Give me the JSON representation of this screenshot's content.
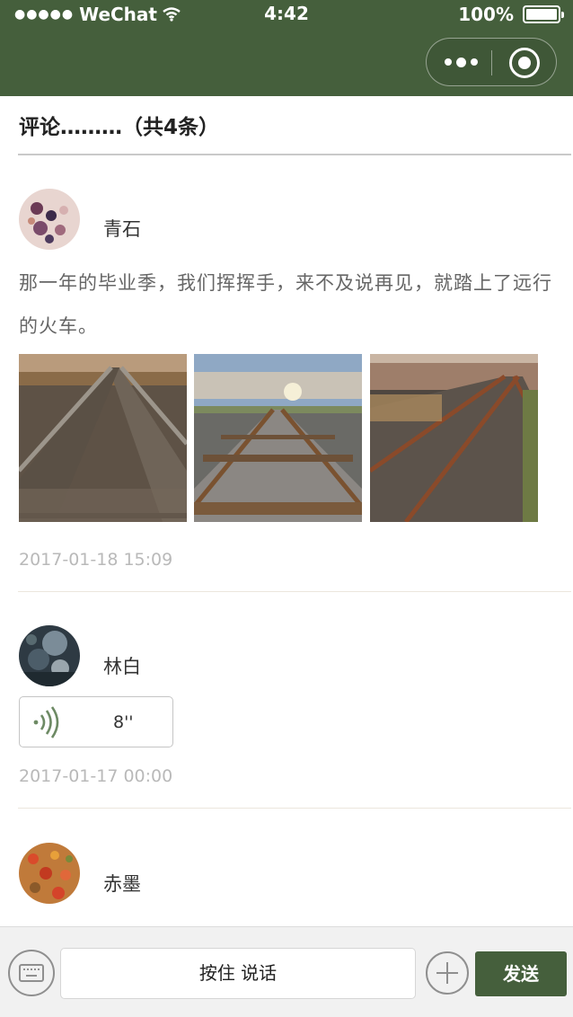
{
  "status_bar": {
    "carrier": "WeChat",
    "time": "4:42",
    "battery": "100%"
  },
  "header": {
    "title": "评论………（共4条）"
  },
  "comments": [
    {
      "name": "青石",
      "text": "那一年的毕业季，我们挥挥手，来不及说再见，就踏上了远行的火车。",
      "date": "2017-01-18 15:09"
    },
    {
      "name": "林白",
      "voice_duration": "8''",
      "date": "2017-01-17 00:00"
    },
    {
      "name": "赤墨"
    }
  ],
  "bottom_bar": {
    "hold_to_talk": "按住 说话",
    "send_label": "发送"
  },
  "colors": {
    "brand": "#455f3c",
    "date_text": "#b9b9b9"
  },
  "icons": [
    "more-icon",
    "close-circle-icon",
    "keyboard-icon",
    "voice-wave-icon",
    "plus-icon"
  ]
}
